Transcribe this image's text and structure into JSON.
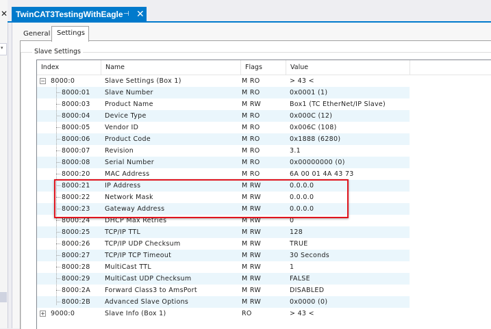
{
  "document_tab": {
    "title": "TwinCAT3TestingWithEagle",
    "pin_icon": "⊣",
    "close_icon": "✕"
  },
  "left_panel": {
    "close_icon": "✕",
    "dropdown_icon": "▾"
  },
  "tabs": {
    "general": "General",
    "settings": "Settings",
    "active": "Settings"
  },
  "group_label": "Slave Settings",
  "columns": {
    "index": "Index",
    "name": "Name",
    "flags": "Flags",
    "value": "Value"
  },
  "highlight_color": "#e0141e",
  "rows": [
    {
      "expander": "−",
      "index": "8000:0",
      "name": "Slave Settings (Box 1)",
      "flags": "M RO",
      "value": "> 43 <"
    },
    {
      "index": "8000:01",
      "name": "Slave Number",
      "flags": "M RO",
      "value": "0x0001 (1)"
    },
    {
      "index": "8000:03",
      "name": "Product Name",
      "flags": "M RW",
      "value": "Box1 (TC EtherNet/IP Slave)"
    },
    {
      "index": "8000:04",
      "name": "Device Type",
      "flags": "M RO",
      "value": "0x000C (12)"
    },
    {
      "index": "8000:05",
      "name": "Vendor ID",
      "flags": "M RO",
      "value": "0x006C (108)"
    },
    {
      "index": "8000:06",
      "name": "Product Code",
      "flags": "M RO",
      "value": "0x1888 (6280)"
    },
    {
      "index": "8000:07",
      "name": "Revision",
      "flags": "M RO",
      "value": "3.1"
    },
    {
      "index": "8000:08",
      "name": "Serial Number",
      "flags": "M RO",
      "value": "0x00000000 (0)"
    },
    {
      "index": "8000:20",
      "name": "MAC Address",
      "flags": "M RO",
      "value": "6A 00 01 4A 43 73"
    },
    {
      "index": "8000:21",
      "name": "IP Address",
      "flags": "M RW",
      "value": "0.0.0.0"
    },
    {
      "index": "8000:22",
      "name": "Network Mask",
      "flags": "M RW",
      "value": "0.0.0.0"
    },
    {
      "index": "8000:23",
      "name": "Gateway Address",
      "flags": "M RW",
      "value": "0.0.0.0"
    },
    {
      "index": "8000:24",
      "name": "DHCP Max Retries",
      "flags": "M RW",
      "value": "0"
    },
    {
      "index": "8000:25",
      "name": "TCP/IP TTL",
      "flags": "M RW",
      "value": "128"
    },
    {
      "index": "8000:26",
      "name": "TCP/IP UDP Checksum",
      "flags": "M RW",
      "value": "TRUE"
    },
    {
      "index": "8000:27",
      "name": "TCP/IP TCP Timeout",
      "flags": "M RW",
      "value": "30 Seconds"
    },
    {
      "index": "8000:28",
      "name": "MultiCast TTL",
      "flags": "M RW",
      "value": "1"
    },
    {
      "index": "8000:29",
      "name": "MultiCast UDP Checksum",
      "flags": "M RW",
      "value": "FALSE"
    },
    {
      "index": "8000:2A",
      "name": "Forward Class3 to AmsPort",
      "flags": "M RW",
      "value": "DISABLED"
    },
    {
      "index": "8000:2B",
      "name": "Advanced Slave Options",
      "flags": "M RW",
      "value": "0x0000 (0)"
    },
    {
      "expander": "+",
      "index": "9000:0",
      "name": "Slave Info (Box 1)",
      "flags": "RO",
      "value": "> 43 <"
    }
  ]
}
